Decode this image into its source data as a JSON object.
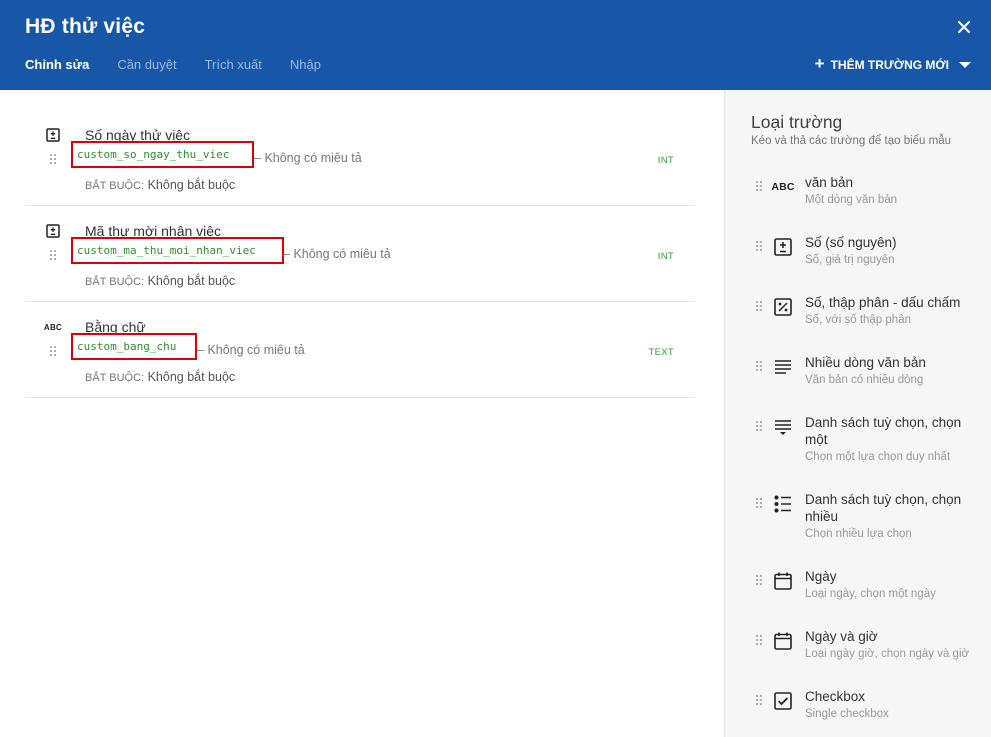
{
  "header": {
    "title": "HĐ thử việc",
    "tabs": [
      {
        "label": "Chỉnh sửa",
        "active": true
      },
      {
        "label": "Cần duyệt",
        "active": false
      },
      {
        "label": "Trích xuất",
        "active": false
      },
      {
        "label": "Nhập",
        "active": false
      }
    ],
    "add_field_label": "THÊM TRƯỜNG MỚI",
    "close_icon": "close-icon",
    "bg_color": "#1857a8"
  },
  "fields": [
    {
      "label": "Số ngày thử việc",
      "key": "custom_so_ngay_thu_viec",
      "description": "Không có miêu tả",
      "required_label": "BẮT BUỘC:",
      "required_value": "Không bắt buộc",
      "type": "INT",
      "icon": "integer-icon"
    },
    {
      "label": "Mã thư mời nhận việc",
      "key": "custom_ma_thu_moi_nhan_viec",
      "description": "Không có miêu tả",
      "required_label": "BẮT BUỘC:",
      "required_value": "Không bắt buộc",
      "type": "INT",
      "icon": "integer-icon"
    },
    {
      "label": "Bằng chữ",
      "key": "custom_bang_chu",
      "description": "Không có miêu tả",
      "required_label": "BẮT BUỘC:",
      "required_value": "Không bắt buộc",
      "type": "TEXT",
      "icon": "abc-icon",
      "icon_text": "ABC"
    }
  ],
  "sidebar": {
    "title": "Loại trường",
    "subtitle": "Kéo và thả các trường để tạo biểu mẫu",
    "items": [
      {
        "name": "văn bản",
        "desc": "Một dòng văn bản",
        "icon": "abc-icon",
        "icon_text": "ABC"
      },
      {
        "name": "Số (số nguyên)",
        "desc": "Số, giá trị nguyên",
        "icon": "integer-icon"
      },
      {
        "name": "Số, thập phân - dấu chấm",
        "desc": "Số, với số thập phân",
        "icon": "percent-icon"
      },
      {
        "name": "Nhiều dòng văn bản",
        "desc": "Văn bản có nhiều dòng",
        "icon": "multiline-icon"
      },
      {
        "name": "Danh sách tuỳ chọn, chọn một",
        "desc": "Chọn một lựa chọn duy nhất",
        "icon": "single-select-icon"
      },
      {
        "name": "Danh sách tuỳ chọn, chọn nhiều",
        "desc": "Chọn nhiều lựa chọn",
        "icon": "multi-select-icon"
      },
      {
        "name": "Ngày",
        "desc": "Loại ngày, chọn một ngày",
        "icon": "calendar-icon"
      },
      {
        "name": "Ngày và giờ",
        "desc": "Loại ngày giờ, chọn ngày và giờ",
        "icon": "calendar-clock-icon"
      },
      {
        "name": "Checkbox",
        "desc": "Single checkbox",
        "icon": "checkbox-icon"
      }
    ]
  },
  "colors": {
    "header": "#1857a8",
    "key_text": "#2e8f2e",
    "highlight_border": "#e00000",
    "sidebar_bg": "#f6f6f6"
  }
}
